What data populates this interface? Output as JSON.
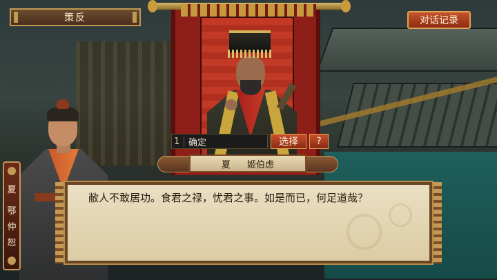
{
  "header": {
    "title": "策反"
  },
  "log_button": {
    "label": "对话记录"
  },
  "selection": {
    "number": "1",
    "option": "确定",
    "select_label": "选择",
    "help_label": "?"
  },
  "speaker": {
    "faction": "夏",
    "name": "姬伯虑"
  },
  "left_character": {
    "faction": "夏",
    "name_chars": [
      "鄂",
      "仲",
      "恕"
    ]
  },
  "dialog": {
    "text": "敝人不敢居功。食君之禄，忧君之事。如是而已，何足道哉？"
  },
  "colors": {
    "accent": "#c9502a",
    "frame": "#c39a55",
    "parchment": "#eadfc3",
    "banner": "#8e1e18"
  }
}
